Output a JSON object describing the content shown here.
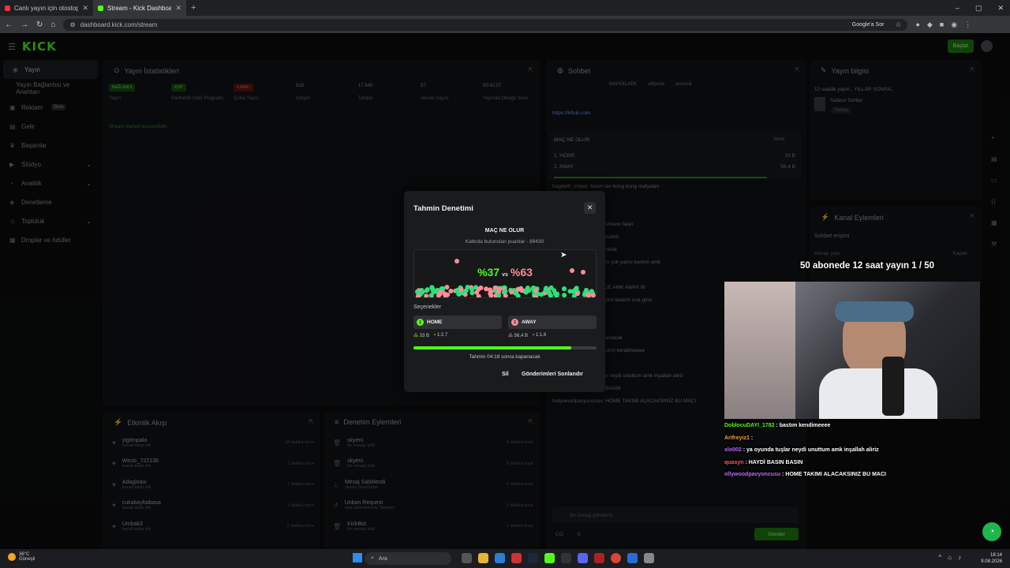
{
  "browser": {
    "tabs": [
      {
        "label": "Canlı yayın için otostop konse"
      },
      {
        "label": "Stream - Kick Dashboard"
      }
    ],
    "url": "dashboard.kick.com/stream",
    "google_ask": "Google'a Sor"
  },
  "header": {
    "logo": "KICK",
    "start_label": "Başlat"
  },
  "sidebar": {
    "items": [
      {
        "label": "Yayın"
      },
      {
        "label": "Yayın Bağlantısı ve Anahtarı"
      },
      {
        "label": "Reklam",
        "badge": "Beta"
      },
      {
        "label": "Gelir"
      },
      {
        "label": "Başarılar"
      },
      {
        "label": "Stüdyo"
      },
      {
        "label": "Analitik"
      },
      {
        "label": "Denetleme"
      },
      {
        "label": "Topluluk"
      },
      {
        "label": "Droplar ve ödüller"
      }
    ]
  },
  "stats_panel": {
    "title": "Yayın İstatistikleri",
    "stats": [
      {
        "value": "BAĞLANDI",
        "label": "Yayın"
      },
      {
        "value": "KOP",
        "label": "Partnerlik Gelir Programı"
      },
      {
        "value": "KAPALI",
        "label": "Çoklu Yayın"
      },
      {
        "value": "918",
        "label": "İzleyici"
      },
      {
        "value": "17.640",
        "label": "Takipçi"
      },
      {
        "value": "57",
        "label": "Abone Sayısı"
      },
      {
        "value": "00:42:57",
        "label": "Yayında Olduğu Süre"
      }
    ],
    "status_msg": "Stream started successfully"
  },
  "activity_panel": {
    "title": "Etkinlik Akışı",
    "rows": [
      {
        "name": "yigitmpala",
        "sub": "kanali takip etti",
        "time": "34 dakika önce"
      },
      {
        "name": "Wezic_722136",
        "sub": "kanali takip etti",
        "time": "2 dakika önce"
      },
      {
        "name": "Adagioqw",
        "sub": "kanali takip etti",
        "time": "7 dakika önce"
      },
      {
        "name": "cukabaybabasa",
        "sub": "kanali takip etti",
        "time": "2 dakika önce"
      },
      {
        "name": "Umbak3",
        "sub": "kanali takip etti",
        "time": "5 dakika önce"
      }
    ]
  },
  "mod_panel": {
    "title": "Denetim Eylemleri",
    "rows": [
      {
        "name": "skyeni",
        "sub": "bir mesajı sildi",
        "time": "0 dakika önce"
      },
      {
        "name": "skyeni",
        "sub": "bir mesajı sildi",
        "time": "0 dakika önce"
      },
      {
        "name": "Mesaj Sabitlendi",
        "sub": "skyeni tarafından",
        "time": "0 dakika önce"
      },
      {
        "name": "Unban Request",
        "sub": "was submitted by Tarqeen",
        "time": "0 dakika önce"
      },
      {
        "name": "KickBot",
        "sub": "bir mesajı sildi",
        "time": "1 dakika önce"
      }
    ]
  },
  "chat_panel": {
    "title": "Sohbet",
    "pinned_users": [
      "MAHOILAEK",
      "ultipode",
      "arcsnuk"
    ],
    "pinned_link": "https://kifuki.com",
    "poll": {
      "title": "MAÇ NE OLUR",
      "vote": "Veret",
      "options": [
        {
          "label": "1. HOME",
          "value": "33 B"
        },
        {
          "label": "2. AWAY",
          "value": "56,4 B"
        }
      ]
    },
    "messages": [
      "bagdeth_sniper: basın lan hong kong mafyaları",
      "basın",
      "oyunu",
      "abi ses hikayesi anlat ashtann falan",
      "göster bate one göre basalım",
      "hdr ya yatıplemem hevhalda",
      "hom a 300 bastım param yok yarısı bastım amk",
      "açda geldim",
      "37: PEPE VAR ARKAYDE AMK AWAY W",
      "şehir müftüsüne her şeyimi bastım ona göre",
      "lisayisi",
      "SUIGHAST: Şike var",
      "synwessa: kırışıklık kazanacak",
      "DoblocuDAYI_1782: bastım kendimeeee",
      "Arifreyiz1:",
      "xlo002: ya oyunda tuşlar neydi unuttum amk inşallah aliriz",
      "quasyn: HAYDI BASIN BASIN",
      "hollywoodpavyoncusu: HOME TAKIMI ALACAKSINIZ BU MACI"
    ],
    "input_placeholder": "Bir mesaj gönderin",
    "send_label": "Gönder",
    "counts": [
      "CO",
      "0"
    ]
  },
  "info_panel": {
    "title": "Yayın bilgisi",
    "stream_title": "12 saatlik yayın.. YILLAR SONRA..",
    "category": "Sadece Sohbet",
    "lang": "Türkiye"
  },
  "actions_panel": {
    "title": "Kanal Eylemleri",
    "sub": "Sohbet erişimi",
    "row1": "Hesap yaşı",
    "row1v": "Kapalı"
  },
  "modal": {
    "title": "Tahmin Denetimi",
    "question": "MAÇ NE OLUR",
    "points": "Katkıda bulunulan puanlar - 89430",
    "home_pct": "%37",
    "vs": "vs",
    "away_pct": "%63",
    "options_label": "Seçenekler",
    "options": [
      {
        "num": "1",
        "label": "HOME",
        "points": "33 B",
        "ratio": "1:2.7"
      },
      {
        "num": "2",
        "label": "AWAY",
        "points": "56,4 B",
        "ratio": "1:1.6"
      }
    ],
    "progress": 0.86,
    "closing": "Tahmin 04:18 sonra kapanacak",
    "delete": "Sil",
    "end": "Gönderimleri Sonlandır"
  },
  "overlay": {
    "subgoal": "50 abonede 12 saat yayın 1 / 50",
    "chat": [
      {
        "user": "DoblocuDAYI_1782",
        "text": " : bastım kendimeeee",
        "color": "#53fc18"
      },
      {
        "user": "Arifreyiz1",
        "text": " : ",
        "color": "#f7a33a"
      },
      {
        "user": "xlo002",
        "text": " : ya oyunda tuşlar neydi unuttum amk inşallah aliriz",
        "color": "#b66cff"
      },
      {
        "user": "quasyn",
        "text": " : HAYDİ BASIN BASIN",
        "color": "#ff5a5a"
      },
      {
        "user": "ollywoodpavyoncusu",
        "text": " : HOME TAKIMI ALACAKSINIZ BU MACI",
        "color": "#b66cff"
      }
    ]
  },
  "taskbar": {
    "weather_temp": "36°C",
    "weather_desc": "Güneşli",
    "search": "Ara",
    "time": "18:14",
    "date": "9.08.2026"
  }
}
